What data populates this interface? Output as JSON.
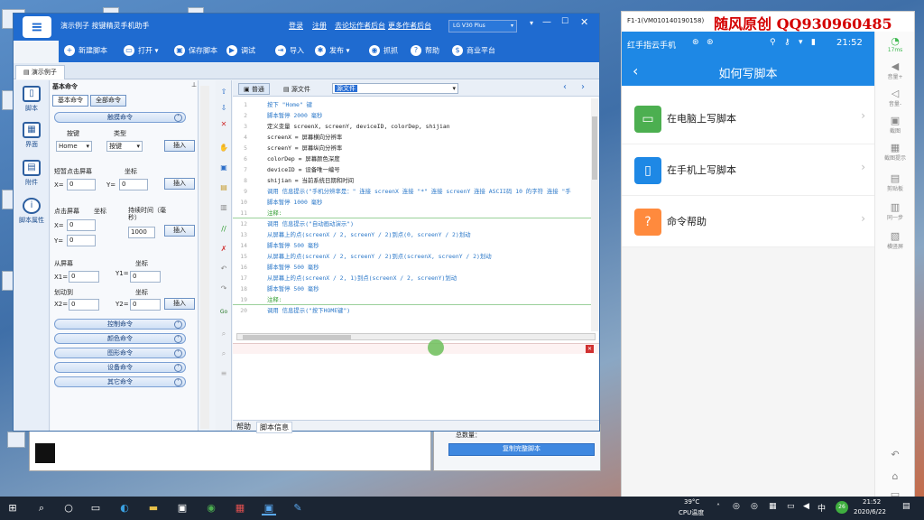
{
  "window": {
    "title": "演示例子 按键精灵手机助手",
    "links": [
      "登录",
      "注册",
      "去论坛作者后台",
      "更多作者后台"
    ],
    "device_select": "LG V30 Plus"
  },
  "toolbar": {
    "new_script": "新建脚本",
    "open": "打开",
    "save_script": "保存脚本",
    "debug": "调试",
    "import": "导入",
    "publish": "发布",
    "capture": "抓抓",
    "help": "帮助",
    "business": "商业平台"
  },
  "doc_tab": "演示例子",
  "sidenav": {
    "items": [
      "脚本",
      "界面",
      "附件",
      "脚本属性"
    ]
  },
  "cmdpanel": {
    "title": "基本命令",
    "tabs": [
      "基本命令",
      "全部命令"
    ],
    "section_touch": "触摸命令",
    "key_label": "按键",
    "type_label": "类型",
    "key_value": "Home",
    "type_value": "按键",
    "insert": "插入",
    "tap_label": "短暂点击屏幕",
    "coord_label": "坐标",
    "x_eq": "X=",
    "y_eq": "Y=",
    "x_val": "0",
    "y_val": "0",
    "long_press_label": "点击屏幕",
    "duration_label": "持续时间（毫秒）",
    "duration_value": "1000",
    "from_screen": "从屏幕",
    "x1": "X1=",
    "y1": "Y1=",
    "swipe_to": "划动到",
    "x2": "X2=",
    "y2": "Y2=",
    "sections": [
      "控制命令",
      "颜色命令",
      "图形命令",
      "设备命令",
      "其它命令"
    ]
  },
  "editor": {
    "tabs": [
      "普通",
      "源文件"
    ],
    "dropdown": "源文件",
    "lines": [
      "按下 \"Home\" 键",
      "脚本暂停 2000 毫秒",
      "定义变量 screenX, screenY, deviceID, colorDep, shijian",
      "screenX = 屏幕横向分辨率",
      "screenY = 屏幕纵向分辨率",
      "colorDep = 屏幕颜色深度",
      "deviceID = 设备唯一编号",
      "shijian = 当前系统日期和时间",
      "调用 信息提示(\"手机分辨率是：\" 连接 screenX 连接 \"*\" 连接 screenY 连接 ASCII码 10 的字符 连接 \"手",
      "脚本暂停 1000 毫秒",
      "注释:",
      "调用 信息提示(\"自动画动演示\")",
      "从屏幕上的点(screenX / 2, screenY / 2)到点(0, screenY / 2)划动",
      "脚本暂停 500 毫秒",
      "从屏幕上的点(screenX / 2, screenY / 2)到点(screenX, screenY / 2)划动",
      "脚本暂停 500 毫秒",
      "从屏幕上的点(screenX / 2, 1)到点(screenX / 2, screenY)划动",
      "脚本暂停 500 毫秒",
      "注释:",
      "调用 信息提示(\"按下HOME键\")"
    ],
    "bottom_tabs": [
      "帮助",
      "脚本信息"
    ]
  },
  "background_window": {
    "button": "复制完整脚本",
    "count_label": "总数量："
  },
  "phone": {
    "header": "F1-1(VM010140190158)",
    "watermark": "随风原创 QQ930960485",
    "statusbar_title": "红手指云手机",
    "clock": "21:52",
    "page_title": "如何写脚本",
    "items": [
      "在电脑上写脚本",
      "在手机上写脚本",
      "命令帮助"
    ],
    "side_labels": [
      "17ms",
      "音量+",
      "音量-",
      "截图",
      "截图提示",
      "剪贴板",
      "同一步",
      "横竖屏"
    ]
  },
  "taskbar": {
    "temp": "39°C",
    "temp_label": "CPU温度",
    "time": "21:52",
    "date": "2020/6/22",
    "badge": "26"
  },
  "colors": {
    "brand_blue": "#1f6bd0",
    "phone_blue": "#1e88e5",
    "watermark_red": "#d40000"
  }
}
